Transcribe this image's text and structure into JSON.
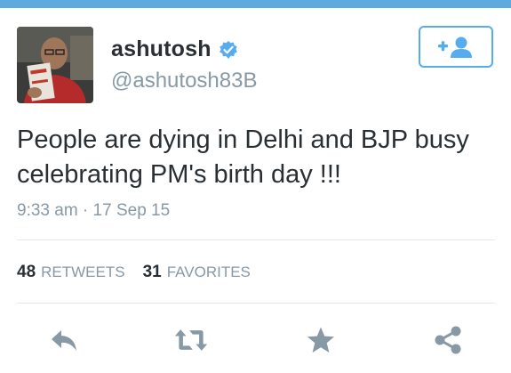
{
  "tweet": {
    "user": {
      "display_name": "ashutosh",
      "handle": "@ashutosh83B",
      "verified": true,
      "avatar_icon": "user-avatar"
    },
    "follow_icon": "add-user-icon",
    "text": "People are dying in Delhi and BJP busy celebrating PM's birth day !!!",
    "timestamp": "9:33 am · 17 Sep 15",
    "stats": {
      "retweets": {
        "count": "48",
        "label": "RETWEETS"
      },
      "favorites": {
        "count": "31",
        "label": "FAVORITES"
      }
    },
    "actions": {
      "reply_icon": "reply-icon",
      "retweet_icon": "retweet-icon",
      "favorite_icon": "star-icon",
      "share_icon": "share-icon"
    }
  },
  "colors": {
    "accent": "#55acee",
    "text_primary": "#292f33",
    "text_secondary": "#8899a6",
    "action_icon": "#8899a6",
    "divider": "#e1e8ed",
    "top_bar": "#5ea9dd"
  }
}
